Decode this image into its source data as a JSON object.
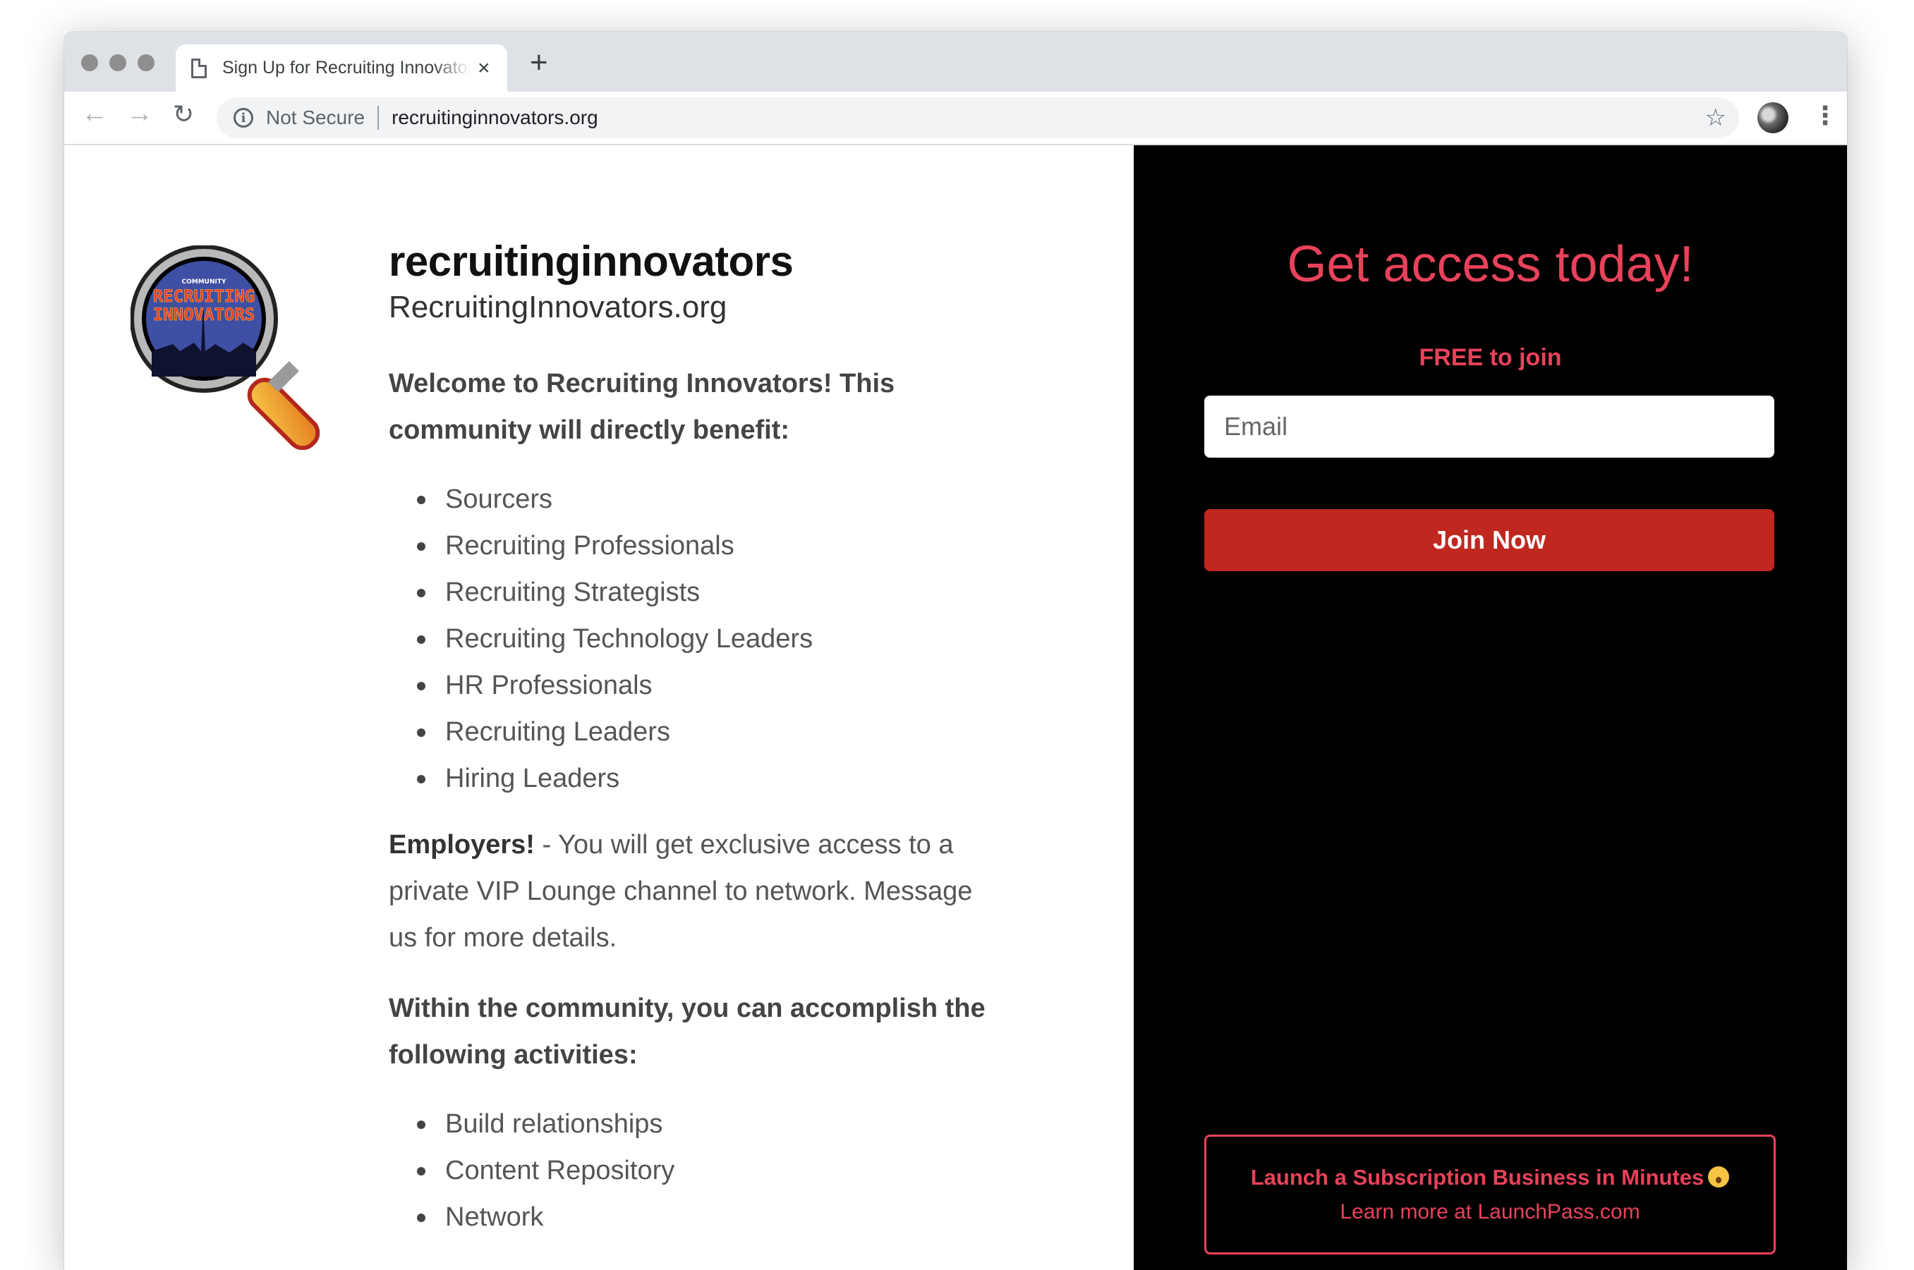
{
  "browser": {
    "tab_title": "Sign Up for Recruiting Innovators",
    "tab_close": "×",
    "new_tab": "+",
    "security_label": "Not Secure",
    "url": "recruitinginnovators.org"
  },
  "community": {
    "name": "recruitinginnovators",
    "site": "RecruitingInnovators.org",
    "intro": "Welcome to Recruiting Innovators! This community will directly benefit:",
    "audience": [
      "Sourcers",
      "Recruiting Professionals",
      "Recruiting Strategists",
      "Recruiting Technology Leaders",
      "HR Professionals",
      "Recruiting Leaders",
      "Hiring Leaders"
    ],
    "employers_bold": "Employers!",
    "employers_text": " - You will get exclusive access to a private VIP Lounge channel to network. Message us for more details.",
    "activities_heading": "Within the community, you can accomplish the following activities:",
    "activities": [
      "Build relationships",
      "Content Repository",
      "Network"
    ],
    "logo": {
      "small_text": "COMMUNITY",
      "line1": "RECRUITING",
      "line2": "INNOVATORS"
    }
  },
  "signup": {
    "headline": "Get access today!",
    "price": "FREE to join",
    "email_placeholder": "Email",
    "button": "Join Now"
  },
  "promo": {
    "title": "Launch a Subscription Business in Minutes",
    "link": "Learn more at LaunchPass.com"
  },
  "colors": {
    "accent": "#e8425a",
    "button": "#bf271f",
    "panel": "#000000"
  }
}
